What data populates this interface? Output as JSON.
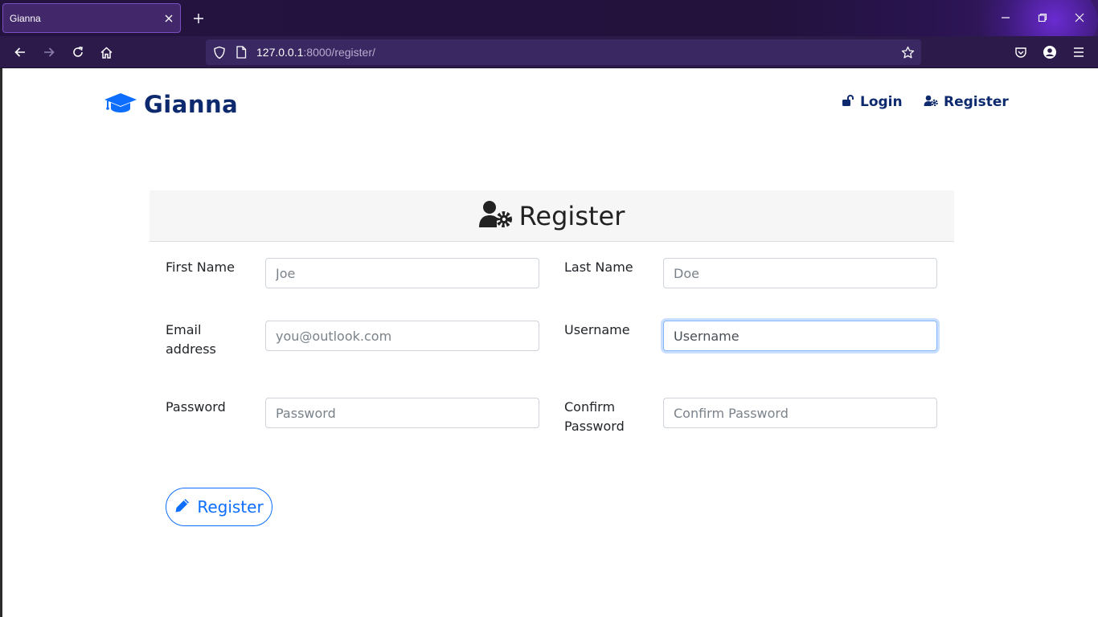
{
  "browser": {
    "tab_title": "Gianna",
    "url_host": "127.0.0.1",
    "url_rest": ":8000/register/"
  },
  "site": {
    "brand": "Gianna",
    "nav": {
      "login": "Login",
      "register": "Register"
    }
  },
  "form": {
    "title": "Register",
    "first_name": {
      "label": "First Name",
      "placeholder": "Joe"
    },
    "last_name": {
      "label": "Last Name",
      "placeholder": "Doe"
    },
    "email": {
      "label": "Email address",
      "placeholder": "you@outlook.com"
    },
    "username": {
      "label": "Username",
      "placeholder": "Username"
    },
    "password": {
      "label": "Password",
      "placeholder": "Password"
    },
    "confirm_password": {
      "label": "Confirm Password",
      "placeholder": "Confirm Password"
    },
    "submit_label": "Register"
  },
  "colors": {
    "brand": "#0d2a6e",
    "accent": "#0d6efd",
    "chrome": "#2b1a4a"
  }
}
